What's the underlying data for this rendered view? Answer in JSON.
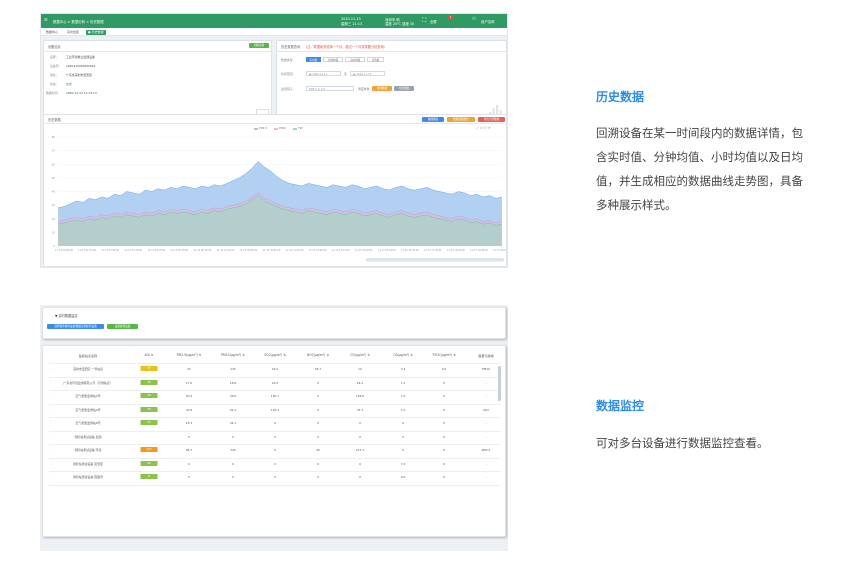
{
  "history_screen": {
    "topbar": {
      "title": "数据中心 > 数据分析 > 历史数据",
      "datetime": "2020-11-13",
      "weekday": "星期三 11:13",
      "weather_city": "深圳市 晴",
      "weather_temp": "温度 20℃ 湿度 30",
      "notification_count": "1",
      "fullscreen_label": "全屏",
      "user_label": "用户名称"
    },
    "tabs": [
      {
        "label": "数据中心"
      },
      {
        "label": "实时监控"
      },
      {
        "label": "● 历史数据"
      }
    ],
    "device_info": {
      "title": "设备信息",
      "switch_button": "切换设备",
      "fields": [
        {
          "label": "名称：",
          "value": "工业环境粉尘监测设备"
        },
        {
          "label": "设备号：",
          "value": "2020112010000001"
        },
        {
          "label": "地址：",
          "value": "广东省深圳市宝安区"
        },
        {
          "label": "状态：",
          "value": "在线"
        },
        {
          "label": "数据时间：",
          "value": "2020-11-13 11:13:13"
        }
      ]
    },
    "query": {
      "title": "历史数据查询",
      "warning": "（注：数据最多选择一个月、超过一个月将需要分批查询）",
      "data_type_label": "数据类型：",
      "data_types": [
        "实时值",
        "分钟均值",
        "小时均值",
        "日均值"
      ],
      "time_range_label": "时间范围：",
      "start_date": "2020-11-13",
      "range_separator": "至",
      "end_date": "2020-11-13",
      "factor_label": "监测因子：",
      "factor_placeholder": "PM2.5 ⊕ 1/3",
      "clear_button": "清空条件",
      "query_button": "查询数据",
      "export_button": "导出数据"
    },
    "chart_panel": {
      "title": "历史数据",
      "buttons": [
        "曲线图表",
        "数据表格统计",
        "导出全部数据"
      ],
      "legend": [
        "PM2.5",
        "PM10",
        "TSP"
      ]
    }
  },
  "monitor_screen": {
    "panel_title": "实时数据监控",
    "buttons": [
      "选择要查看的设备/数据定制显示设备",
      "设置监测设备"
    ],
    "columns": [
      "监控站点名称",
      "AQI",
      "PM2.5(μg/m³)",
      "PM10(μg/m³)",
      "SO2(μg/m³)",
      "NO2(μg/m³)",
      "CO(μg/m³)",
      "O3(μg/m³)",
      "TVOC(μg/m³)",
      "首要污染物"
    ],
    "rows": [
      {
        "name": "深圳市宝安区 一号站点",
        "aqi": "37",
        "aqi_color": "#e8c21a",
        "values": [
          "22",
          "125",
          "44.0",
          "56.7",
          "10",
          "3.4",
          "0.0"
        ],
        "primary": "PM10"
      },
      {
        "name": "广东省环境监测有限公司（示例站点）",
        "aqi": "36",
        "aqi_color": "#8bc34a",
        "values": [
          "17.0",
          "18.6",
          "22.0",
          "0",
          "24.2",
          "7.2",
          "0"
        ],
        "primary": "-"
      },
      {
        "name": "空气质量监测站2号",
        "aqi": "44",
        "aqi_color": "#8bc34a",
        "values": [
          "30.4",
          "35.0",
          "150.7",
          "0",
          "153.6",
          "7.0",
          "0"
        ],
        "primary": "-"
      },
      {
        "name": "空气质量监测站4号",
        "aqi": "38",
        "aqi_color": "#8bc34a",
        "values": [
          "30.9",
          "32.1",
          "103.4",
          "0",
          "35.7",
          "7.0",
          "0"
        ],
        "primary": "SO2"
      },
      {
        "name": "空气质量监测站6号",
        "aqi": "43",
        "aqi_color": "#8bc34a",
        "values": [
          "23.3",
          "34.1",
          "0",
          "0",
          "0",
          "0",
          "0"
        ],
        "primary": "-"
      },
      {
        "name": "测控站测试设备-监测",
        "aqi": "",
        "aqi_color": "",
        "values": [
          "0",
          "0",
          "0",
          "0",
          "0",
          "0",
          "0"
        ],
        "primary": "-"
      },
      {
        "name": "测控站测试设备-环境",
        "aqi": "127",
        "aqi_color": "#f39a1e",
        "values": [
          "96.7",
          "745",
          "5",
          "40",
          "211.3",
          "5",
          "0"
        ],
        "primary": "PM2.5"
      },
      {
        "name": "测控站测试设备-宝安区",
        "aqi": "16",
        "aqi_color": "#8bc34a",
        "values": [
          "0",
          "0",
          "0",
          "0",
          "0",
          "7.2",
          "0"
        ],
        "primary": "-"
      },
      {
        "name": "测控站测试设备-西丽号",
        "aqi": "6",
        "aqi_color": "#8bc34a",
        "values": [
          "0",
          "0",
          "0",
          "0",
          "0",
          "0.0",
          "0"
        ],
        "primary": "-"
      }
    ]
  },
  "sections": [
    {
      "heading": "历史数据",
      "description": "回溯设备在某一时间段内的数据详情，包含实时值、分钟均值、小时均值以及日均值，并生成相应的数据曲线走势图，具备多种展示样式。"
    },
    {
      "heading": "数据监控",
      "description": "可对多台设备进行数据监控查看。"
    }
  ],
  "colors": {
    "nav_green": "#2f9a64",
    "accent_blue": "#2e8ee6",
    "series_pm25": "#a5c8ee",
    "series_pm10": "#e8b4e0",
    "series_tsp": "#9fd9b6"
  },
  "chart_data": {
    "type": "area",
    "title": "",
    "xlabel": "",
    "ylabel": "",
    "ylim": [
      0,
      80
    ],
    "yticks": [
      0,
      10,
      20,
      30,
      40,
      50,
      60,
      70,
      80
    ],
    "x_ticks": [
      "11-13 00:00:00",
      "11-13 01:07:00",
      "11-13 02:05:00",
      "11-13 03:16:00",
      "11-13 04:22:00",
      "11-13 05:28:00",
      "11-13 06:34:00",
      "11-13 07:40:00",
      "11-13 08:46:00",
      "11-13 09:52:00",
      "11-13 11:00:00",
      "11-13 12:06:00",
      "11-13 13:12:00",
      "11-13 14:18:00",
      "11-13 15:24:00",
      "11-13 16:30:00",
      "11-13 17:36:00",
      "11-13 18:42:00",
      "11-13 19:48:00",
      "11-13 20:54:00"
    ],
    "series": [
      {
        "name": "PM2.5",
        "values": [
          28,
          29,
          31,
          33,
          32,
          35,
          34,
          36,
          35,
          38,
          37,
          40,
          39,
          38,
          41,
          40,
          42,
          41,
          43,
          42,
          44,
          43,
          42,
          44,
          43,
          45,
          44,
          46,
          48,
          50,
          53,
          57,
          62,
          58,
          55,
          51,
          48,
          46,
          45,
          44,
          46,
          45,
          44,
          43,
          45,
          44,
          43,
          45,
          44,
          42,
          43,
          44,
          42,
          41,
          43,
          44,
          42,
          41,
          42,
          43,
          41,
          40,
          39,
          38,
          40,
          39,
          37,
          38,
          36,
          37,
          35,
          36
        ]
      },
      {
        "name": "PM10",
        "values": [
          18,
          19,
          20,
          21,
          20,
          22,
          21,
          23,
          22,
          24,
          23,
          25,
          24,
          23,
          25,
          24,
          26,
          25,
          27,
          26,
          27,
          26,
          25,
          27,
          26,
          28,
          27,
          29,
          30,
          31,
          33,
          36,
          39,
          35,
          33,
          31,
          29,
          28,
          27,
          26,
          28,
          27,
          26,
          25,
          27,
          26,
          25,
          27,
          26,
          24,
          25,
          26,
          24,
          23,
          25,
          26,
          24,
          23,
          24,
          25,
          23,
          22,
          21,
          20,
          22,
          21,
          19,
          20,
          18,
          19,
          17,
          18
        ]
      },
      {
        "name": "TSP",
        "values": [
          16,
          17,
          18,
          19,
          18,
          20,
          19,
          21,
          20,
          22,
          21,
          23,
          22,
          21,
          23,
          22,
          24,
          23,
          25,
          24,
          25,
          24,
          23,
          25,
          24,
          26,
          25,
          27,
          28,
          29,
          31,
          34,
          37,
          33,
          31,
          29,
          27,
          26,
          25,
          24,
          26,
          25,
          24,
          23,
          25,
          24,
          23,
          25,
          24,
          22,
          23,
          24,
          22,
          21,
          23,
          24,
          22,
          21,
          22,
          23,
          21,
          20,
          19,
          18,
          20,
          19,
          17,
          18,
          16,
          17,
          15,
          16
        ]
      }
    ]
  }
}
